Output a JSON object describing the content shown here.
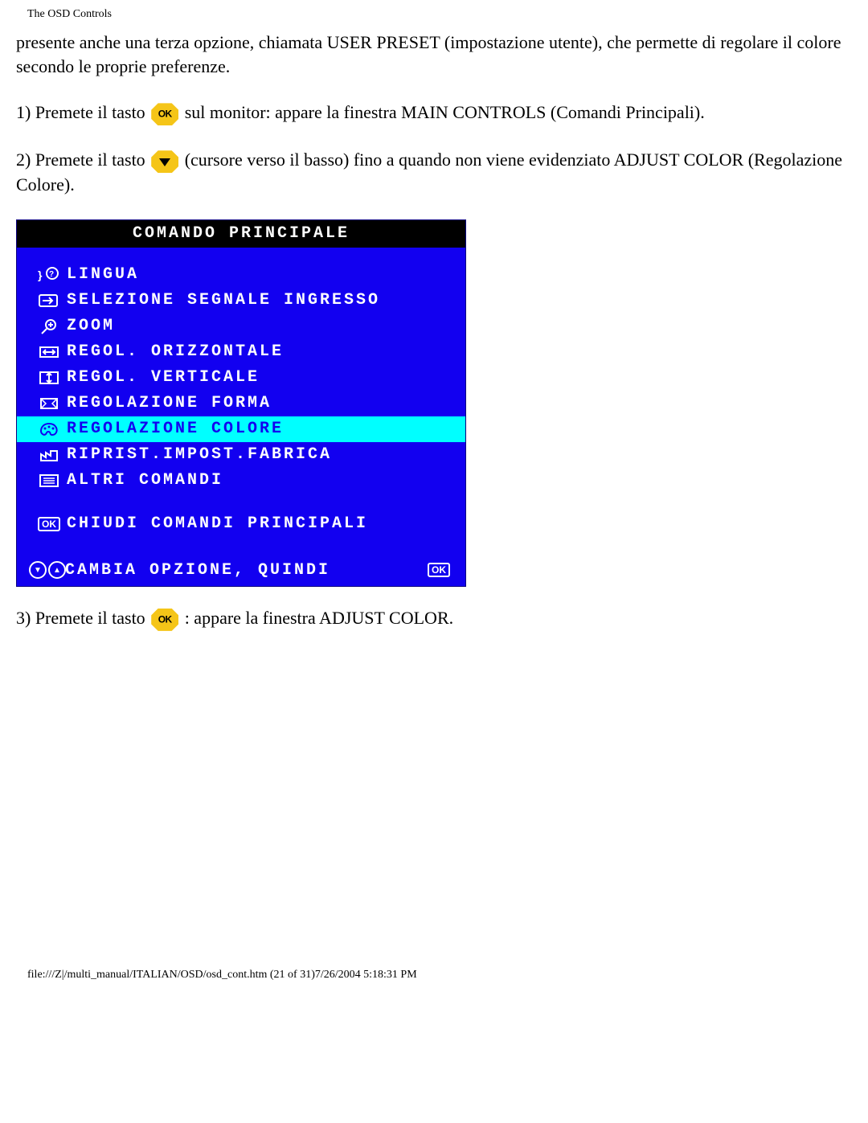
{
  "header": "The OSD Controls",
  "intro": "presente anche una terza opzione, chiamata USER PRESET (impostazione utente), che permette di regolare il colore secondo le proprie preferenze.",
  "step1_pre": "1) Premete il tasto ",
  "step1_post": " sul monitor: appare la finestra MAIN CONTROLS (Comandi Principali).",
  "step2_pre": "2) Premete il tasto ",
  "step2_post": " (cursore verso il basso) fino a quando non viene evidenziato ADJUST COLOR (Regolazione Colore).",
  "step3_pre": "3) Premete il tasto ",
  "step3_post": " : appare la finestra ADJUST COLOR.",
  "ok_label": "OK",
  "osd": {
    "title": "COMANDO PRINCIPALE",
    "items": [
      {
        "label": "LINGUA"
      },
      {
        "label": "SELEZIONE SEGNALE INGRESSO"
      },
      {
        "label": "ZOOM"
      },
      {
        "label": "REGOL. ORIZZONTALE"
      },
      {
        "label": "REGOL. VERTICALE"
      },
      {
        "label": "REGOLAZIONE FORMA"
      },
      {
        "label": "REGOLAZIONE COLORE"
      },
      {
        "label": "RIPRIST.IMPOST.FABRICA"
      },
      {
        "label": "ALTRI COMANDI"
      }
    ],
    "exit_label": "CHIUDI COMANDI PRINCIPALI",
    "footer_label": "CAMBIA OPZIONE, QUINDI"
  },
  "footer": "file:///Z|/multi_manual/ITALIAN/OSD/osd_cont.htm (21 of 31)7/26/2004 5:18:31 PM"
}
